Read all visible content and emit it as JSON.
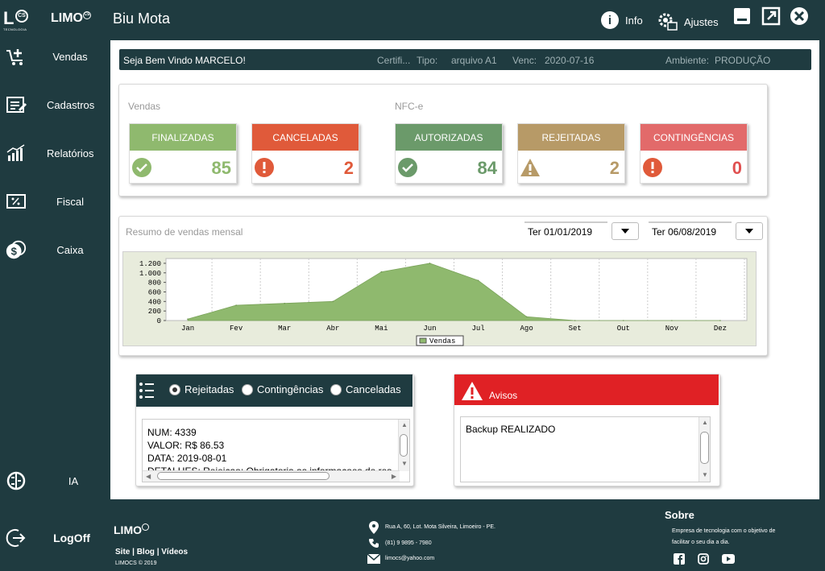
{
  "app": {
    "title": "Biu Mota",
    "logo_brand": "LIMO",
    "info_label": "Info",
    "settings_label": "Ajustes"
  },
  "sidebar": {
    "items": [
      {
        "label": "Vendas",
        "icon": "cart-plus-icon"
      },
      {
        "label": "Cadastros",
        "icon": "edit-form-icon"
      },
      {
        "label": "Relatórios",
        "icon": "bar-chart-icon"
      },
      {
        "label": "Fiscal",
        "icon": "percent-tag-icon"
      },
      {
        "label": "Caixa",
        "icon": "coins-icon"
      },
      {
        "label": "IA",
        "icon": "brain-icon"
      },
      {
        "label": "LogOff",
        "icon": "logout-icon"
      }
    ]
  },
  "welcome": {
    "greeting": "Seja Bem Vindo MARCELO!",
    "cert_label": "Certifi...",
    "type_label": "Tipo:",
    "type_value": "arquivo A1",
    "venc_label": "Venc:",
    "venc_value": "2020-07-16",
    "env_label": "Ambiente:",
    "env_value": "PRODUÇÃO"
  },
  "stats": {
    "vendas_title": "Vendas",
    "nfce_title": "NFC-e",
    "cards": [
      {
        "label": "FINALIZADAS",
        "value": "85",
        "color": "#8fb96e",
        "num_color": "#8fb96e"
      },
      {
        "label": "CANCELADAS",
        "value": "2",
        "color": "#e05a3a",
        "num_color": "#e05a3a"
      },
      {
        "label": "AUTORIZADAS",
        "value": "84",
        "color": "#6b9a6a",
        "num_color": "#6b9a6a"
      },
      {
        "label": "REJEITADAS",
        "value": "2",
        "color": "#b79a67",
        "num_color": "#b79a67"
      },
      {
        "label": "CONTINGÊNCIAS",
        "value": "0",
        "color": "#e26a6a",
        "num_color": "#e05050"
      }
    ]
  },
  "summary": {
    "title": "Resumo de vendas mensal",
    "date_from": "Ter 01/01/2019",
    "date_to": "Ter 06/08/2019"
  },
  "chart_data": {
    "type": "area",
    "categories": [
      "Jan",
      "Fev",
      "Mar",
      "Abr",
      "Mai",
      "Jun",
      "Jul",
      "Ago",
      "Set",
      "Out",
      "Nov",
      "Dez"
    ],
    "series": [
      {
        "name": "Vendas",
        "values": [
          30,
          320,
          360,
          400,
          1020,
          1200,
          840,
          80,
          0,
          0,
          0,
          0
        ],
        "color": "#8fb96e"
      }
    ],
    "yticks": [
      "0",
      "200",
      "400",
      "600",
      "800",
      "1.000",
      "1.200"
    ],
    "ylim": [
      0,
      1300
    ],
    "grid": true,
    "legend": "bottom"
  },
  "list": {
    "options": [
      "Rejeitadas",
      "Contingências",
      "Canceladas"
    ],
    "selected": 0,
    "lines": [
      "NUM: 4339",
      "VALOR: R$ 86.53",
      "DATA: 2019-08-01",
      "DETALHES: Rejeicao: Obrigatoria as informacoes de res"
    ]
  },
  "avisos": {
    "title": "Avisos",
    "message": "Backup REALIZADO"
  },
  "footer": {
    "brand": "LIMO",
    "links": "Site |  Blog |  Vídeos",
    "copyright": "LIMOCS © 2019",
    "address": "Rua A, 60, Lot. Mota Silveira, Limoeiro - PE.",
    "phone": "(81) 9 9895 - 7980",
    "email": "limocs@yahoo.com",
    "about_title": "Sobre",
    "about_text_1": "Empresa de tecnologia com o objetivo de",
    "about_text_2": "facilitar o seu dia a dia."
  }
}
